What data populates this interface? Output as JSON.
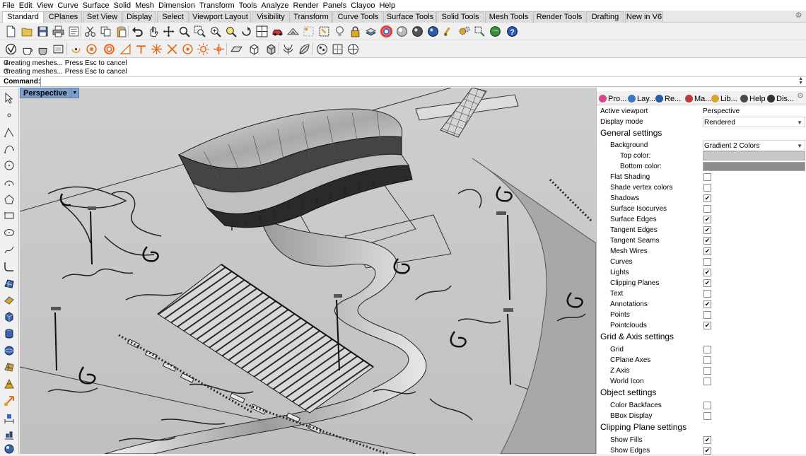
{
  "menu": [
    "File",
    "Edit",
    "View",
    "Curve",
    "Surface",
    "Solid",
    "Mesh",
    "Dimension",
    "Transform",
    "Tools",
    "Analyze",
    "Render",
    "Panels",
    "Clayoo",
    "Help"
  ],
  "tabs": [
    {
      "label": "Standard",
      "active": true
    },
    {
      "label": "CPlanes"
    },
    {
      "label": "Set View"
    },
    {
      "label": "Display"
    },
    {
      "label": "Select"
    },
    {
      "label": "Viewport Layout"
    },
    {
      "label": "Visibility"
    },
    {
      "label": "Transform"
    },
    {
      "label": "Curve Tools"
    },
    {
      "label": "Surface Tools"
    },
    {
      "label": "Solid Tools"
    },
    {
      "label": "Mesh Tools"
    },
    {
      "label": "Render Tools"
    },
    {
      "label": "Drafting"
    },
    {
      "label": "New in V6"
    }
  ],
  "command": {
    "history": [
      "Creating meshes... Press Esc to cancel",
      "Creating meshes... Press Esc to cancel"
    ],
    "prompt_label": "Command:",
    "input_value": ""
  },
  "viewport": {
    "name": "Perspective"
  },
  "panel": {
    "tabs": [
      {
        "label": "Pro...",
        "icon": "properties-icon",
        "color": "#d04a8a"
      },
      {
        "label": "Lay...",
        "icon": "layers-icon",
        "color": "#3a76c4"
      },
      {
        "label": "Re...",
        "icon": "render-icon",
        "color": "#2a5aa8"
      },
      {
        "label": "Ma...",
        "icon": "materials-icon",
        "color": "#c0393b"
      },
      {
        "label": "Lib...",
        "icon": "libraries-icon",
        "color": "#d9a52a"
      },
      {
        "label": "Help",
        "icon": "help-icon",
        "color": "#4a4a4a"
      },
      {
        "label": "Dis...",
        "icon": "display-icon",
        "color": "#333333"
      }
    ],
    "active_viewport": {
      "label": "Active viewport",
      "value": "Perspective"
    },
    "display_mode": {
      "label": "Display mode",
      "value": "Rendered"
    },
    "general_title": "General settings",
    "background": {
      "label": "Background",
      "value": "Gradient 2 Colors"
    },
    "top_color": {
      "label": "Top color:",
      "color": "#c8c8c8"
    },
    "bottom_color": {
      "label": "Bottom color:",
      "color": "#8c8c8c"
    },
    "general": [
      {
        "label": "Flat Shading",
        "checked": false
      },
      {
        "label": "Shade vertex colors",
        "checked": false
      },
      {
        "label": "Shadows",
        "checked": true
      },
      {
        "label": "Surface Isocurves",
        "checked": false
      },
      {
        "label": "Surface Edges",
        "checked": true
      },
      {
        "label": "Tangent Edges",
        "checked": true
      },
      {
        "label": "Tangent Seams",
        "checked": true
      },
      {
        "label": "Mesh Wires",
        "checked": true
      },
      {
        "label": "Curves",
        "checked": false
      },
      {
        "label": "Lights",
        "checked": true
      },
      {
        "label": "Clipping Planes",
        "checked": true
      },
      {
        "label": "Text",
        "checked": false
      },
      {
        "label": "Annotations",
        "checked": true
      },
      {
        "label": "Points",
        "checked": false
      },
      {
        "label": "Pointclouds",
        "checked": true
      }
    ],
    "grid_title": "Grid & Axis settings",
    "grid": [
      {
        "label": "Grid",
        "checked": false
      },
      {
        "label": "CPlane Axes",
        "checked": false
      },
      {
        "label": "Z Axis",
        "checked": false
      },
      {
        "label": "World Icon",
        "checked": false
      }
    ],
    "object_title": "Object settings",
    "object": [
      {
        "label": "Color Backfaces",
        "checked": false
      },
      {
        "label": "BBox Display",
        "checked": false
      }
    ],
    "clipping_title": "Clipping Plane settings",
    "clipping": [
      {
        "label": "Show Fills",
        "checked": true
      },
      {
        "label": "Show Edges",
        "checked": true
      }
    ]
  },
  "checkmark": "✔"
}
